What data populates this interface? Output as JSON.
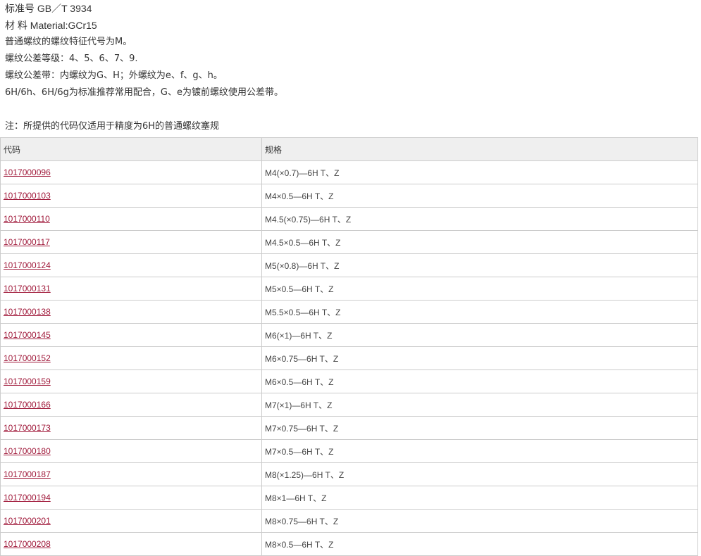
{
  "info": {
    "standard": "标准号 GB／T 3934",
    "material": "材 料 Material:GCr15",
    "line1": "普通螺纹的螺纹特征代号为M。",
    "line2": "螺纹公差等级：4、5、6、7、9.",
    "line3": "螺纹公差带：内螺纹为G、H；外螺纹为e、f、g、h。",
    "line4": "6H/6h、6H/6g为标准推荐常用配合，G、e为镀前螺纹使用公差带。",
    "note": "注：所提供的代码仅适用于精度为6H的普通螺纹塞规"
  },
  "table": {
    "headers": [
      "代码",
      "规格"
    ],
    "rows": [
      {
        "code": "1017000096",
        "spec": "M4(×0.7)—6H T、Z"
      },
      {
        "code": "1017000103",
        "spec": "M4×0.5—6H T、Z"
      },
      {
        "code": "1017000110",
        "spec": "M4.5(×0.75)—6H T、Z"
      },
      {
        "code": "1017000117",
        "spec": "M4.5×0.5—6H T、Z"
      },
      {
        "code": "1017000124",
        "spec": "M5(×0.8)—6H T、Z"
      },
      {
        "code": "1017000131",
        "spec": "M5×0.5—6H T、Z"
      },
      {
        "code": "1017000138",
        "spec": "M5.5×0.5—6H T、Z"
      },
      {
        "code": "1017000145",
        "spec": "M6(×1)—6H T、Z"
      },
      {
        "code": "1017000152",
        "spec": "M6×0.75—6H T、Z"
      },
      {
        "code": "1017000159",
        "spec": "M6×0.5—6H T、Z"
      },
      {
        "code": "1017000166",
        "spec": "M7(×1)—6H T、Z"
      },
      {
        "code": "1017000173",
        "spec": "M7×0.75—6H T、Z"
      },
      {
        "code": "1017000180",
        "spec": "M7×0.5—6H T、Z"
      },
      {
        "code": "1017000187",
        "spec": "M8(×1.25)—6H T、Z"
      },
      {
        "code": "1017000194",
        "spec": "M8×1—6H T、Z"
      },
      {
        "code": "1017000201",
        "spec": "M8×0.75—6H T、Z"
      },
      {
        "code": "1017000208",
        "spec": "M8×0.5—6H T、Z"
      }
    ]
  },
  "colors": {
    "link": "#a0193a",
    "header_bg": "#efefef",
    "border": "#cccccc"
  }
}
